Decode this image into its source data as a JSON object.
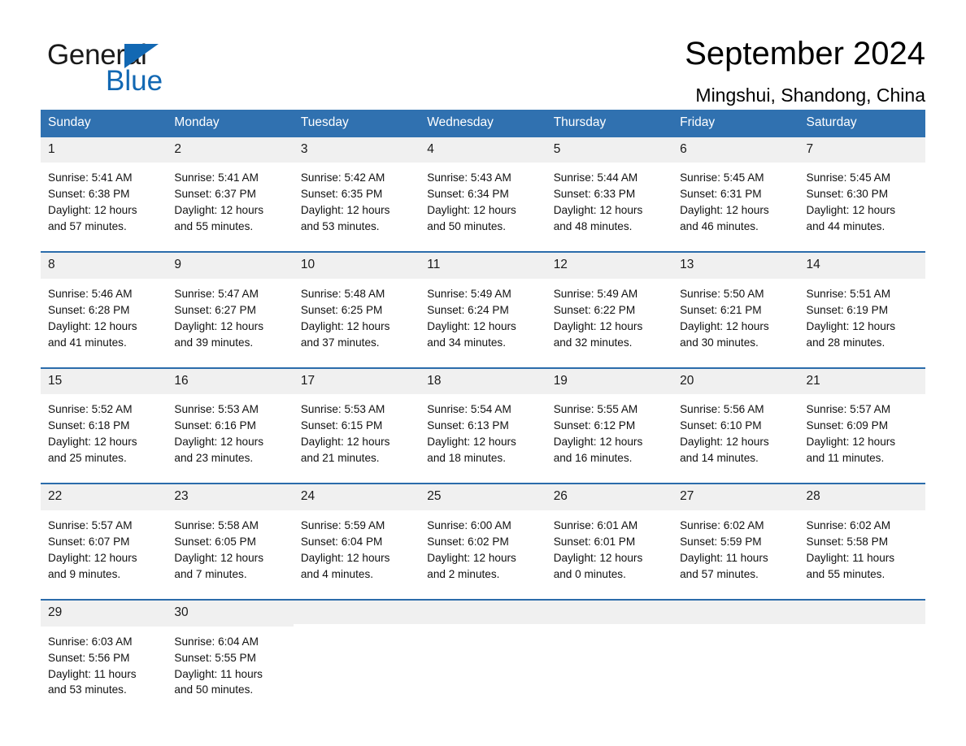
{
  "brand": {
    "name_part1": "General",
    "name_part2": "Blue",
    "triangle_icon": "triangle-icon",
    "accent_color": "#1268b3"
  },
  "header": {
    "title": "September 2024",
    "location": "Mingshui, Shandong, China"
  },
  "calendar": {
    "header_bg": "#3071b0",
    "row_rule_color": "#2b6cab",
    "date_band_bg": "#f0f0f0",
    "weekdays": [
      "Sunday",
      "Monday",
      "Tuesday",
      "Wednesday",
      "Thursday",
      "Friday",
      "Saturday"
    ],
    "weeks": [
      [
        {
          "date": "1",
          "sunrise": "Sunrise: 5:41 AM",
          "sunset": "Sunset: 6:38 PM",
          "daylight_line1": "Daylight: 12 hours",
          "daylight_line2": "and 57 minutes."
        },
        {
          "date": "2",
          "sunrise": "Sunrise: 5:41 AM",
          "sunset": "Sunset: 6:37 PM",
          "daylight_line1": "Daylight: 12 hours",
          "daylight_line2": "and 55 minutes."
        },
        {
          "date": "3",
          "sunrise": "Sunrise: 5:42 AM",
          "sunset": "Sunset: 6:35 PM",
          "daylight_line1": "Daylight: 12 hours",
          "daylight_line2": "and 53 minutes."
        },
        {
          "date": "4",
          "sunrise": "Sunrise: 5:43 AM",
          "sunset": "Sunset: 6:34 PM",
          "daylight_line1": "Daylight: 12 hours",
          "daylight_line2": "and 50 minutes."
        },
        {
          "date": "5",
          "sunrise": "Sunrise: 5:44 AM",
          "sunset": "Sunset: 6:33 PM",
          "daylight_line1": "Daylight: 12 hours",
          "daylight_line2": "and 48 minutes."
        },
        {
          "date": "6",
          "sunrise": "Sunrise: 5:45 AM",
          "sunset": "Sunset: 6:31 PM",
          "daylight_line1": "Daylight: 12 hours",
          "daylight_line2": "and 46 minutes."
        },
        {
          "date": "7",
          "sunrise": "Sunrise: 5:45 AM",
          "sunset": "Sunset: 6:30 PM",
          "daylight_line1": "Daylight: 12 hours",
          "daylight_line2": "and 44 minutes."
        }
      ],
      [
        {
          "date": "8",
          "sunrise": "Sunrise: 5:46 AM",
          "sunset": "Sunset: 6:28 PM",
          "daylight_line1": "Daylight: 12 hours",
          "daylight_line2": "and 41 minutes."
        },
        {
          "date": "9",
          "sunrise": "Sunrise: 5:47 AM",
          "sunset": "Sunset: 6:27 PM",
          "daylight_line1": "Daylight: 12 hours",
          "daylight_line2": "and 39 minutes."
        },
        {
          "date": "10",
          "sunrise": "Sunrise: 5:48 AM",
          "sunset": "Sunset: 6:25 PM",
          "daylight_line1": "Daylight: 12 hours",
          "daylight_line2": "and 37 minutes."
        },
        {
          "date": "11",
          "sunrise": "Sunrise: 5:49 AM",
          "sunset": "Sunset: 6:24 PM",
          "daylight_line1": "Daylight: 12 hours",
          "daylight_line2": "and 34 minutes."
        },
        {
          "date": "12",
          "sunrise": "Sunrise: 5:49 AM",
          "sunset": "Sunset: 6:22 PM",
          "daylight_line1": "Daylight: 12 hours",
          "daylight_line2": "and 32 minutes."
        },
        {
          "date": "13",
          "sunrise": "Sunrise: 5:50 AM",
          "sunset": "Sunset: 6:21 PM",
          "daylight_line1": "Daylight: 12 hours",
          "daylight_line2": "and 30 minutes."
        },
        {
          "date": "14",
          "sunrise": "Sunrise: 5:51 AM",
          "sunset": "Sunset: 6:19 PM",
          "daylight_line1": "Daylight: 12 hours",
          "daylight_line2": "and 28 minutes."
        }
      ],
      [
        {
          "date": "15",
          "sunrise": "Sunrise: 5:52 AM",
          "sunset": "Sunset: 6:18 PM",
          "daylight_line1": "Daylight: 12 hours",
          "daylight_line2": "and 25 minutes."
        },
        {
          "date": "16",
          "sunrise": "Sunrise: 5:53 AM",
          "sunset": "Sunset: 6:16 PM",
          "daylight_line1": "Daylight: 12 hours",
          "daylight_line2": "and 23 minutes."
        },
        {
          "date": "17",
          "sunrise": "Sunrise: 5:53 AM",
          "sunset": "Sunset: 6:15 PM",
          "daylight_line1": "Daylight: 12 hours",
          "daylight_line2": "and 21 minutes."
        },
        {
          "date": "18",
          "sunrise": "Sunrise: 5:54 AM",
          "sunset": "Sunset: 6:13 PM",
          "daylight_line1": "Daylight: 12 hours",
          "daylight_line2": "and 18 minutes."
        },
        {
          "date": "19",
          "sunrise": "Sunrise: 5:55 AM",
          "sunset": "Sunset: 6:12 PM",
          "daylight_line1": "Daylight: 12 hours",
          "daylight_line2": "and 16 minutes."
        },
        {
          "date": "20",
          "sunrise": "Sunrise: 5:56 AM",
          "sunset": "Sunset: 6:10 PM",
          "daylight_line1": "Daylight: 12 hours",
          "daylight_line2": "and 14 minutes."
        },
        {
          "date": "21",
          "sunrise": "Sunrise: 5:57 AM",
          "sunset": "Sunset: 6:09 PM",
          "daylight_line1": "Daylight: 12 hours",
          "daylight_line2": "and 11 minutes."
        }
      ],
      [
        {
          "date": "22",
          "sunrise": "Sunrise: 5:57 AM",
          "sunset": "Sunset: 6:07 PM",
          "daylight_line1": "Daylight: 12 hours",
          "daylight_line2": "and 9 minutes."
        },
        {
          "date": "23",
          "sunrise": "Sunrise: 5:58 AM",
          "sunset": "Sunset: 6:05 PM",
          "daylight_line1": "Daylight: 12 hours",
          "daylight_line2": "and 7 minutes."
        },
        {
          "date": "24",
          "sunrise": "Sunrise: 5:59 AM",
          "sunset": "Sunset: 6:04 PM",
          "daylight_line1": "Daylight: 12 hours",
          "daylight_line2": "and 4 minutes."
        },
        {
          "date": "25",
          "sunrise": "Sunrise: 6:00 AM",
          "sunset": "Sunset: 6:02 PM",
          "daylight_line1": "Daylight: 12 hours",
          "daylight_line2": "and 2 minutes."
        },
        {
          "date": "26",
          "sunrise": "Sunrise: 6:01 AM",
          "sunset": "Sunset: 6:01 PM",
          "daylight_line1": "Daylight: 12 hours",
          "daylight_line2": "and 0 minutes."
        },
        {
          "date": "27",
          "sunrise": "Sunrise: 6:02 AM",
          "sunset": "Sunset: 5:59 PM",
          "daylight_line1": "Daylight: 11 hours",
          "daylight_line2": "and 57 minutes."
        },
        {
          "date": "28",
          "sunrise": "Sunrise: 6:02 AM",
          "sunset": "Sunset: 5:58 PM",
          "daylight_line1": "Daylight: 11 hours",
          "daylight_line2": "and 55 minutes."
        }
      ],
      [
        {
          "date": "29",
          "sunrise": "Sunrise: 6:03 AM",
          "sunset": "Sunset: 5:56 PM",
          "daylight_line1": "Daylight: 11 hours",
          "daylight_line2": "and 53 minutes."
        },
        {
          "date": "30",
          "sunrise": "Sunrise: 6:04 AM",
          "sunset": "Sunset: 5:55 PM",
          "daylight_line1": "Daylight: 11 hours",
          "daylight_line2": "and 50 minutes."
        },
        {
          "date": "",
          "sunrise": "",
          "sunset": "",
          "daylight_line1": "",
          "daylight_line2": ""
        },
        {
          "date": "",
          "sunrise": "",
          "sunset": "",
          "daylight_line1": "",
          "daylight_line2": ""
        },
        {
          "date": "",
          "sunrise": "",
          "sunset": "",
          "daylight_line1": "",
          "daylight_line2": ""
        },
        {
          "date": "",
          "sunrise": "",
          "sunset": "",
          "daylight_line1": "",
          "daylight_line2": ""
        },
        {
          "date": "",
          "sunrise": "",
          "sunset": "",
          "daylight_line1": "",
          "daylight_line2": ""
        }
      ]
    ]
  }
}
